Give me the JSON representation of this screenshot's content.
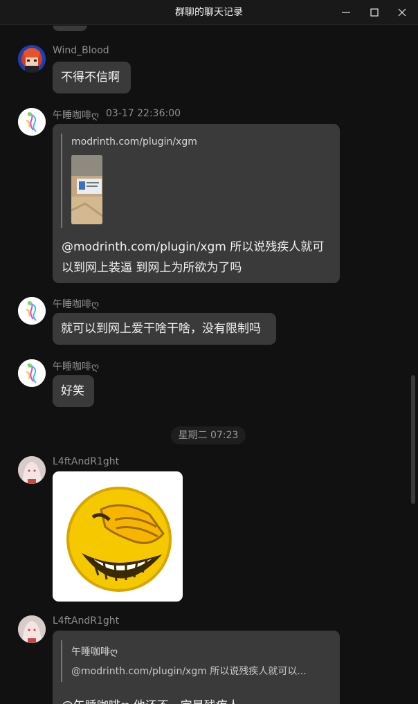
{
  "window": {
    "title": "群聊的聊天记录"
  },
  "messages": [
    {
      "sender": "Wind_Blood",
      "text": "不得不信啊"
    },
    {
      "sender": "午睡咖啡ღ",
      "timestamp": "03-17 22:36:00",
      "quote": {
        "title": "modrinth.com/plugin/xgm"
      },
      "text_line1": "@modrinth.com/plugin/xgm 所以说残疾人就可",
      "text_line2": "以到网上装逼 到网上为所欲为了吗"
    },
    {
      "sender": "午睡咖啡ღ",
      "text": "就可以到网上爱干啥干啥，没有限制吗"
    },
    {
      "sender": "午睡咖啡ღ",
      "text": "好笑"
    },
    {
      "divider": "星期二 07:23"
    },
    {
      "sender": "L4ftAndR1ght",
      "sticker": "laughing-emoji"
    },
    {
      "sender": "L4ftAndR1ght",
      "quote": {
        "title": "午睡咖啡ღ",
        "text": "@modrinth.com/plugin/xgm 所以说残疾人就可以..."
      },
      "text": "@午睡咖啡ღ 他还不一定是残疾人"
    }
  ]
}
